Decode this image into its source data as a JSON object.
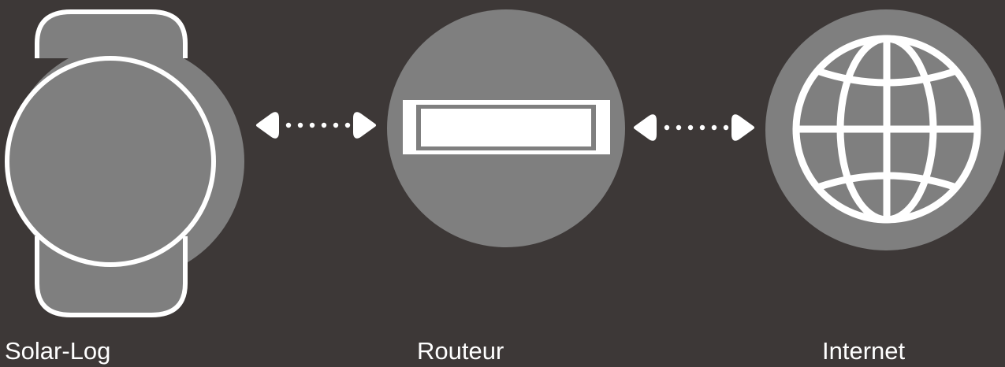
{
  "nodes": [
    {
      "id": "solar-log",
      "label": "Solar-Log",
      "icon": "solar-log-device-icon"
    },
    {
      "id": "router",
      "label": "Routeur",
      "icon": "router-icon"
    },
    {
      "id": "internet",
      "label": "Internet",
      "icon": "globe-icon"
    }
  ],
  "connections": [
    {
      "from": "Solar-Log",
      "to": "Routeur",
      "style": "dotted-bidirectional-arrow"
    },
    {
      "from": "Routeur",
      "to": "Internet",
      "style": "dotted-bidirectional-arrow"
    }
  ],
  "colors": {
    "background": "#3d3837",
    "node_fill": "#7f7f7f",
    "line": "#ffffff"
  }
}
